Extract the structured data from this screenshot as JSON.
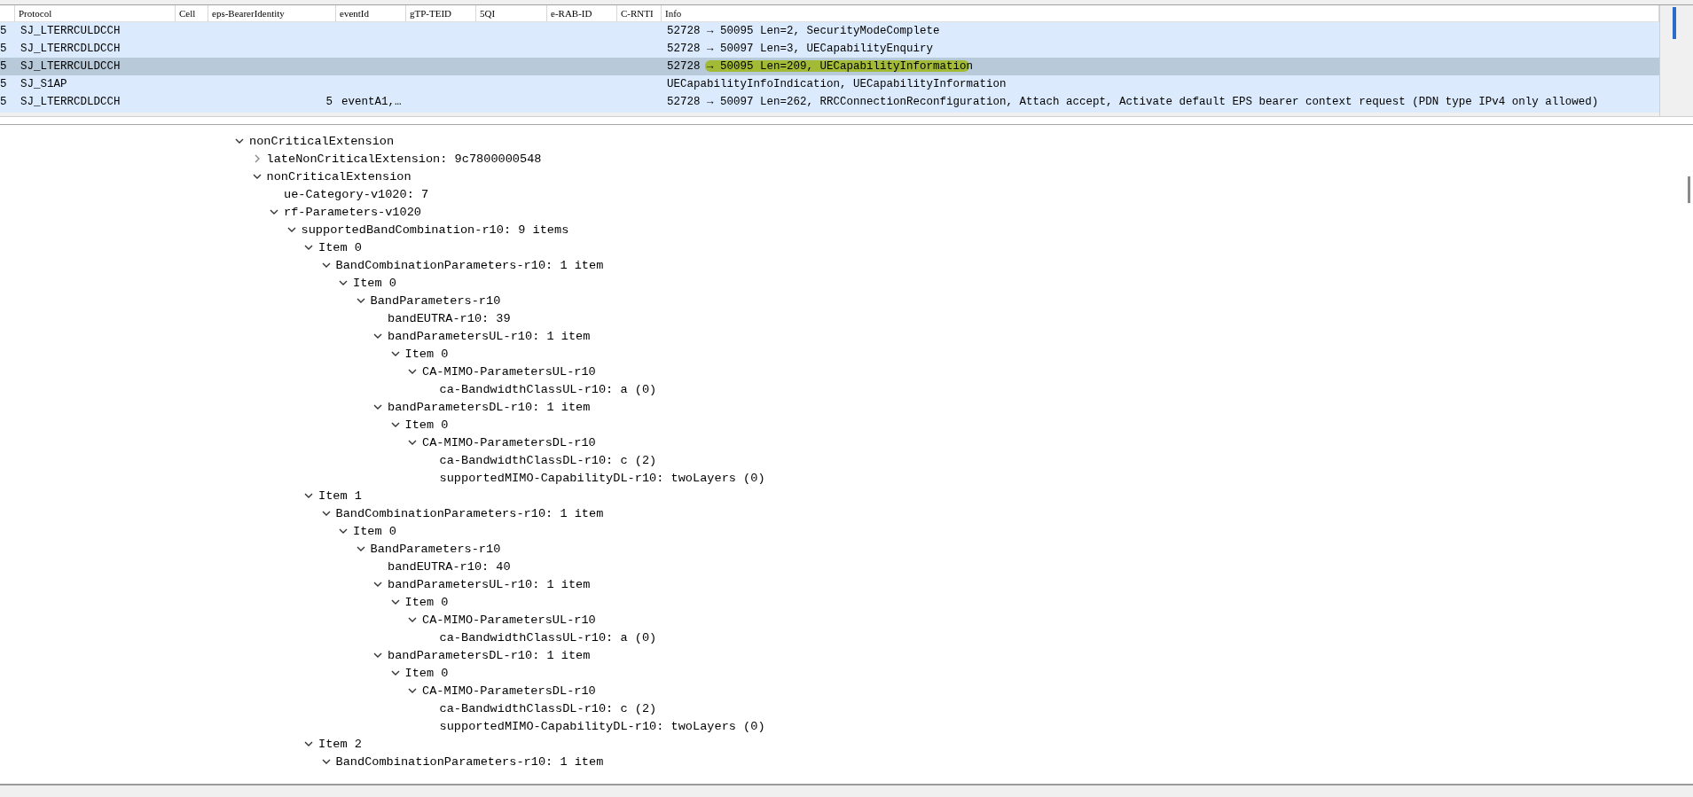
{
  "packets": {
    "columns": [
      null,
      "Protocol",
      "Cell",
      "eps-BearerIdentity",
      "eventId",
      "gTP-TEID",
      "5QI",
      "e-RAB-ID",
      "C-RNTI",
      "Info"
    ],
    "rows": [
      {
        "selected": false,
        "highlighted": false,
        "cells": [
          "5",
          "SJ_LTERRCULDCCH",
          null,
          null,
          null,
          null,
          null,
          null,
          null,
          "52728 → 50095 Len=2, SecurityModeComplete"
        ]
      },
      {
        "selected": false,
        "highlighted": false,
        "cells": [
          "5",
          "SJ_LTERRCDLDCCH",
          null,
          null,
          null,
          null,
          null,
          null,
          null,
          "52728 → 50097 Len=3, UECapabilityEnquiry"
        ]
      },
      {
        "selected": true,
        "highlighted": true,
        "cells": [
          "5",
          "SJ_LTERRCULDCCH",
          null,
          null,
          null,
          null,
          null,
          null,
          null,
          "52728 → 50095 Len=209, UECapabilityInformation"
        ]
      },
      {
        "selected": false,
        "highlighted": false,
        "cells": [
          "5",
          "SJ_S1AP",
          null,
          null,
          null,
          null,
          null,
          null,
          null,
          "UECapabilityInfoIndication, UECapabilityInformation"
        ]
      },
      {
        "selected": false,
        "highlighted": false,
        "cells": [
          "5",
          "SJ_LTERRCDLDCCH",
          null,
          "5",
          "eventA1,…",
          null,
          null,
          null,
          null,
          "52728 → 50097 Len=262, RRCConnectionReconfiguration, Attach accept, Activate default EPS bearer context request (PDN type IPv4 only allowed)"
        ]
      }
    ]
  },
  "tree": [
    {
      "label": "nonCriticalExtension",
      "expanded": true,
      "children": [
        {
          "label": "lateNonCriticalExtension: 9c7800000548",
          "expanded": false
        },
        {
          "label": "nonCriticalExtension",
          "expanded": true,
          "children": [
            {
              "label": "ue-Category-v1020: 7"
            },
            {
              "label": "rf-Parameters-v1020",
              "expanded": true,
              "children": [
                {
                  "label": "supportedBandCombination-r10: 9 items",
                  "expanded": true,
                  "children": [
                    {
                      "label": "Item 0",
                      "expanded": true,
                      "children": [
                        {
                          "label": "BandCombinationParameters-r10: 1 item",
                          "expanded": true,
                          "children": [
                            {
                              "label": "Item 0",
                              "expanded": true,
                              "children": [
                                {
                                  "label": "BandParameters-r10",
                                  "expanded": true,
                                  "children": [
                                    {
                                      "label": "bandEUTRA-r10: 39"
                                    },
                                    {
                                      "label": "bandParametersUL-r10: 1 item",
                                      "expanded": true,
                                      "children": [
                                        {
                                          "label": "Item 0",
                                          "expanded": true,
                                          "children": [
                                            {
                                              "label": "CA-MIMO-ParametersUL-r10",
                                              "expanded": true,
                                              "children": [
                                                {
                                                  "label": "ca-BandwidthClassUL-r10: a (0)"
                                                }
                                              ]
                                            }
                                          ]
                                        }
                                      ]
                                    },
                                    {
                                      "label": "bandParametersDL-r10: 1 item",
                                      "expanded": true,
                                      "children": [
                                        {
                                          "label": "Item 0",
                                          "expanded": true,
                                          "children": [
                                            {
                                              "label": "CA-MIMO-ParametersDL-r10",
                                              "expanded": true,
                                              "children": [
                                                {
                                                  "label": "ca-BandwidthClassDL-r10: c (2)"
                                                },
                                                {
                                                  "label": "supportedMIMO-CapabilityDL-r10: twoLayers (0)"
                                                }
                                              ]
                                            }
                                          ]
                                        }
                                      ]
                                    }
                                  ]
                                }
                              ]
                            }
                          ]
                        }
                      ]
                    },
                    {
                      "label": "Item 1",
                      "expanded": true,
                      "children": [
                        {
                          "label": "BandCombinationParameters-r10: 1 item",
                          "expanded": true,
                          "children": [
                            {
                              "label": "Item 0",
                              "expanded": true,
                              "children": [
                                {
                                  "label": "BandParameters-r10",
                                  "expanded": true,
                                  "children": [
                                    {
                                      "label": "bandEUTRA-r10: 40"
                                    },
                                    {
                                      "label": "bandParametersUL-r10: 1 item",
                                      "expanded": true,
                                      "children": [
                                        {
                                          "label": "Item 0",
                                          "expanded": true,
                                          "children": [
                                            {
                                              "label": "CA-MIMO-ParametersUL-r10",
                                              "expanded": true,
                                              "children": [
                                                {
                                                  "label": "ca-BandwidthClassUL-r10: a (0)"
                                                }
                                              ]
                                            }
                                          ]
                                        }
                                      ]
                                    },
                                    {
                                      "label": "bandParametersDL-r10: 1 item",
                                      "expanded": true,
                                      "children": [
                                        {
                                          "label": "Item 0",
                                          "expanded": true,
                                          "children": [
                                            {
                                              "label": "CA-MIMO-ParametersDL-r10",
                                              "expanded": true,
                                              "children": [
                                                {
                                                  "label": "ca-BandwidthClassDL-r10: c (2)"
                                                },
                                                {
                                                  "label": "supportedMIMO-CapabilityDL-r10: twoLayers (0)"
                                                }
                                              ]
                                            }
                                          ]
                                        }
                                      ]
                                    }
                                  ]
                                }
                              ]
                            }
                          ]
                        }
                      ]
                    },
                    {
                      "label": "Item 2",
                      "expanded": true,
                      "children": [
                        {
                          "label": "BandCombinationParameters-r10: 1 item",
                          "expanded": true
                        }
                      ]
                    }
                  ]
                }
              ]
            }
          ]
        }
      ]
    }
  ]
}
